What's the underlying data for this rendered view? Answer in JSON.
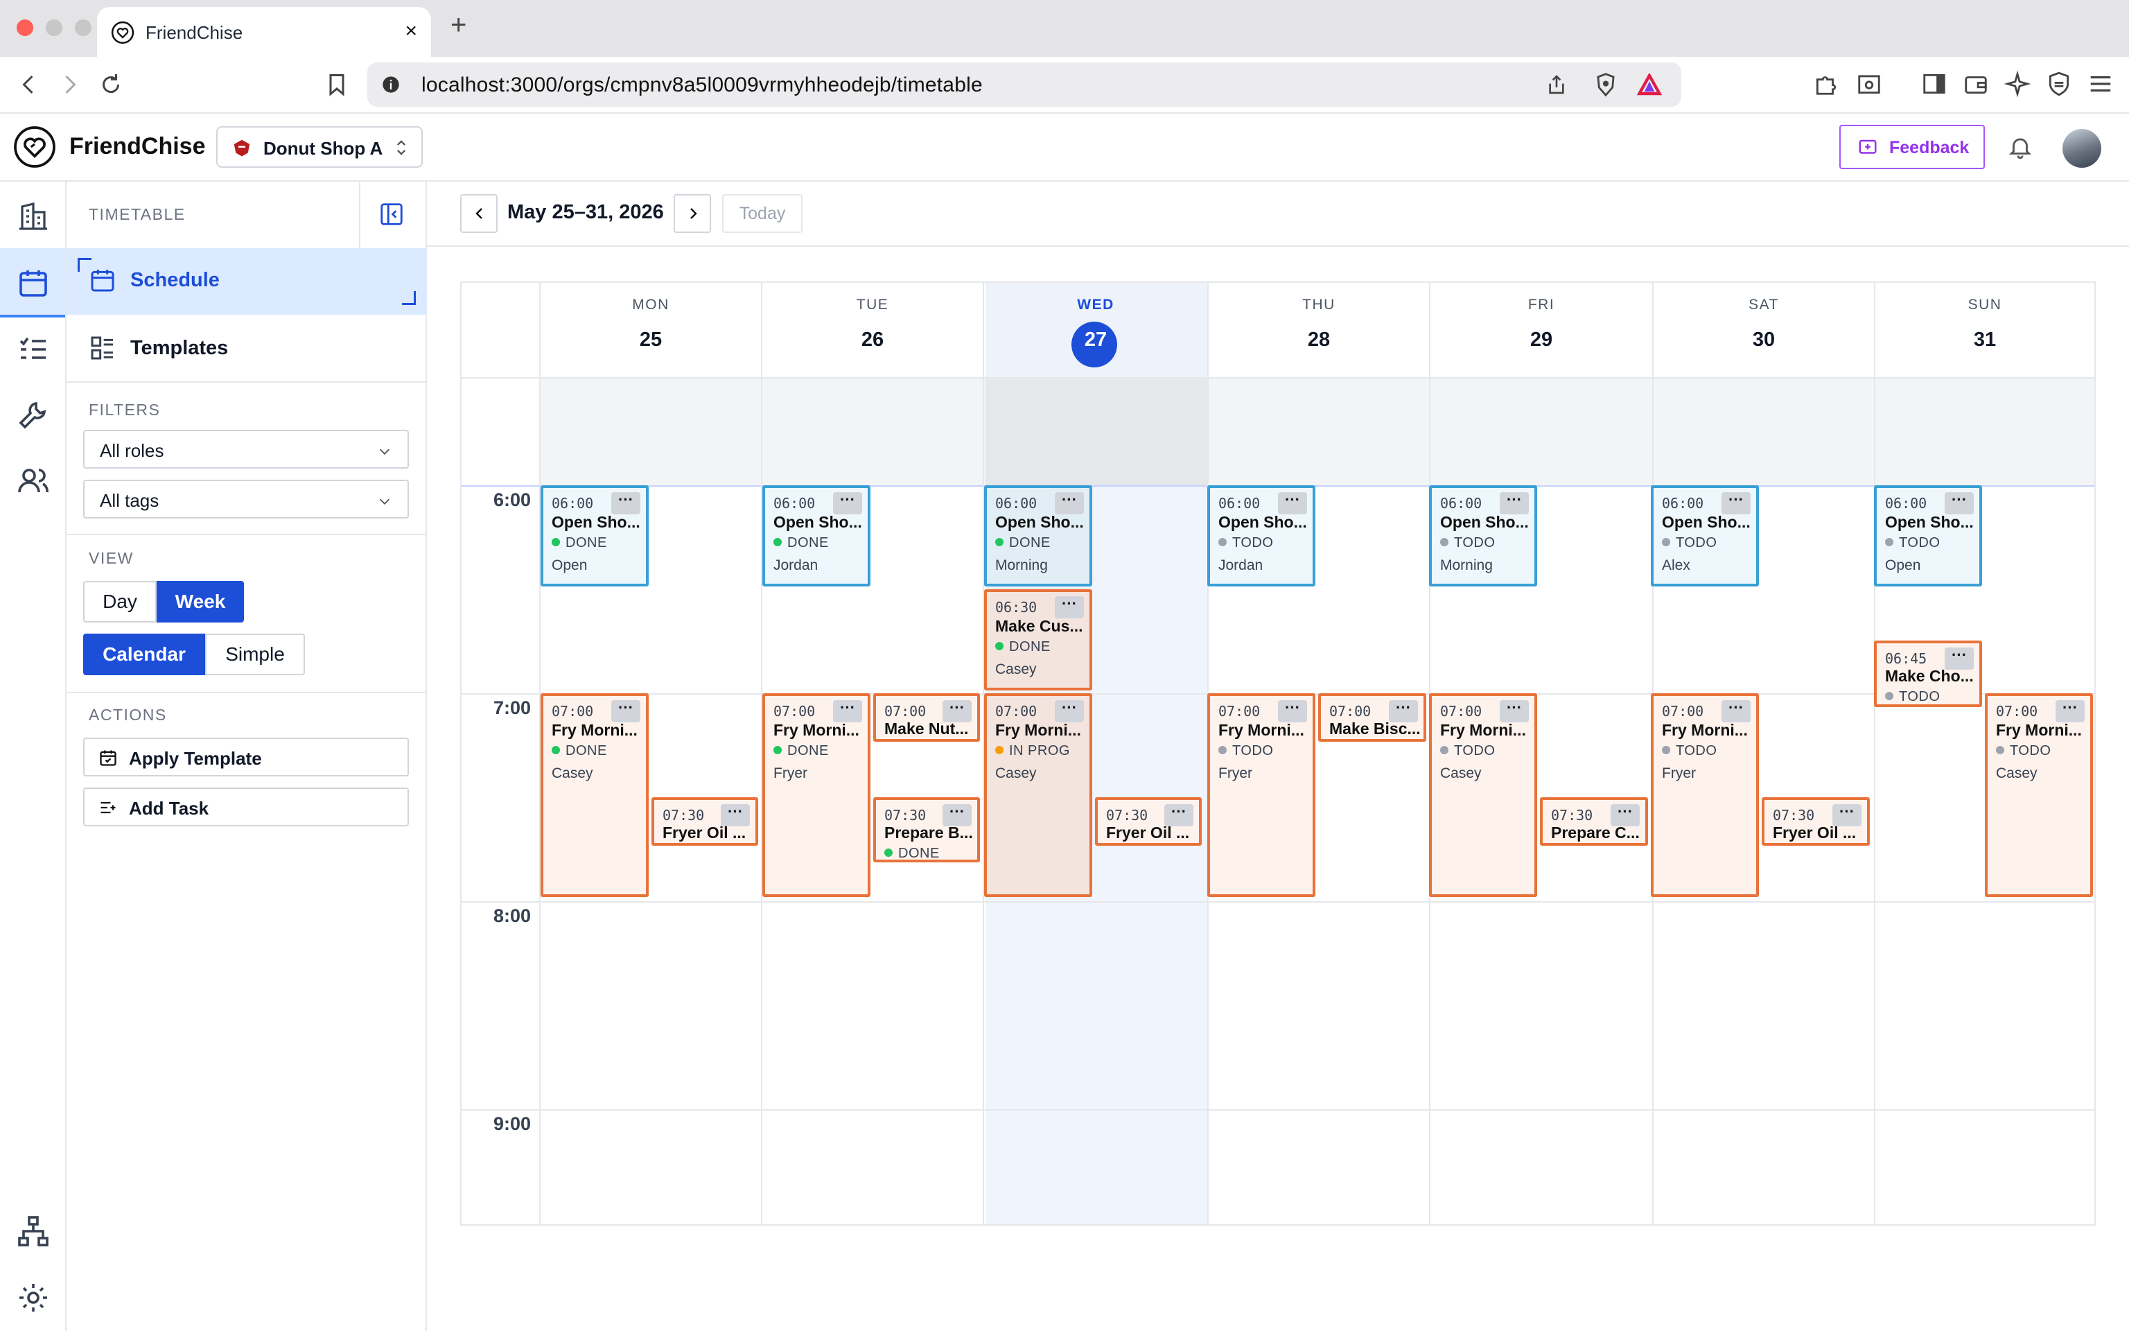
{
  "browser": {
    "tab_title": "FriendChise",
    "tab_close": "×",
    "new_tab": "+",
    "url": "localhost:3000/orgs/cmpnv8a5l0009vrmyhheodejb/timetable"
  },
  "header": {
    "brand": "FriendChise",
    "org": "Donut Shop A",
    "feedback": "Feedback"
  },
  "sidebar": {
    "section": "TIMETABLE",
    "items": [
      {
        "label": "Schedule"
      },
      {
        "label": "Templates"
      }
    ],
    "filters_label": "FILTERS",
    "roles": "All roles",
    "tags": "All tags",
    "view_label": "VIEW",
    "view_day": "Day",
    "view_week": "Week",
    "mode_calendar": "Calendar",
    "mode_simple": "Simple",
    "actions_label": "ACTIONS",
    "apply_template": "Apply Template",
    "add_task": "Add Task"
  },
  "calendar": {
    "range": "May 25–31, 2026",
    "today": "Today",
    "days": [
      {
        "name": "MON",
        "num": "25"
      },
      {
        "name": "TUE",
        "num": "26"
      },
      {
        "name": "WED",
        "num": "27"
      },
      {
        "name": "THU",
        "num": "28"
      },
      {
        "name": "FRI",
        "num": "29"
      },
      {
        "name": "SAT",
        "num": "30"
      },
      {
        "name": "SUN",
        "num": "31"
      }
    ],
    "hours": [
      "6:00",
      "7:00",
      "8:00",
      "9:00"
    ],
    "menu": "···",
    "colors": {
      "opening": "#38a0d6",
      "fryer": "#e8733a",
      "done": "#22c55e",
      "todo": "#9ca3af",
      "inprog": "#f59e0b",
      "today": "#1d4ed8"
    },
    "tasks": [
      {
        "time": "06:00",
        "name": "Open Sho...",
        "status": "DONE",
        "role": "Open"
      },
      {
        "time": "07:00",
        "name": "Fry Morni...",
        "status": "DONE",
        "role": "Casey"
      },
      {
        "time": "07:30",
        "name": "Fryer Oil ..."
      },
      {
        "time": "06:00",
        "name": "Open Sho...",
        "status": "DONE",
        "role": "Jordan"
      },
      {
        "time": "07:00",
        "name": "Fry Morni...",
        "status": "DONE",
        "role": "Fryer"
      },
      {
        "time": "07:00",
        "name": "Make Nut..."
      },
      {
        "time": "07:30",
        "name": "Prepare B...",
        "status": "DONE"
      },
      {
        "time": "06:00",
        "name": "Open Sho...",
        "status": "DONE",
        "role": "Morning"
      },
      {
        "time": "06:30",
        "name": "Make Cus...",
        "status": "DONE",
        "role": "Casey"
      },
      {
        "time": "07:00",
        "name": "Fry Morni...",
        "status": "IN PROG",
        "role": "Casey"
      },
      {
        "time": "07:30",
        "name": "Fryer Oil ..."
      },
      {
        "time": "06:00",
        "name": "Open Sho...",
        "status": "TODO",
        "role": "Jordan"
      },
      {
        "time": "07:00",
        "name": "Fry Morni...",
        "status": "TODO",
        "role": "Fryer"
      },
      {
        "time": "07:00",
        "name": "Make Bisc..."
      },
      {
        "time": "06:00",
        "name": "Open Sho...",
        "status": "TODO",
        "role": "Morning"
      },
      {
        "time": "07:00",
        "name": "Fry Morni...",
        "status": "TODO",
        "role": "Casey"
      },
      {
        "time": "07:30",
        "name": "Prepare C..."
      },
      {
        "time": "06:00",
        "name": "Open Sho...",
        "status": "TODO",
        "role": "Alex"
      },
      {
        "time": "07:00",
        "name": "Fry Morni...",
        "status": "TODO",
        "role": "Fryer"
      },
      {
        "time": "07:30",
        "name": "Fryer Oil ..."
      },
      {
        "time": "06:00",
        "name": "Open Sho...",
        "status": "TODO",
        "role": "Open"
      },
      {
        "time": "06:45",
        "name": "Make Cho...",
        "status": "TODO"
      },
      {
        "time": "07:00",
        "name": "Fry Morni...",
        "status": "TODO",
        "role": "Casey"
      }
    ]
  },
  "icons": [
    "heart-logo-icon",
    "building-icon",
    "calendar-icon",
    "checklist-icon",
    "wrench-icon",
    "users-icon",
    "org-chart-icon",
    "gear-icon",
    "bell-icon",
    "bookmark-icon",
    "reload-icon"
  ]
}
